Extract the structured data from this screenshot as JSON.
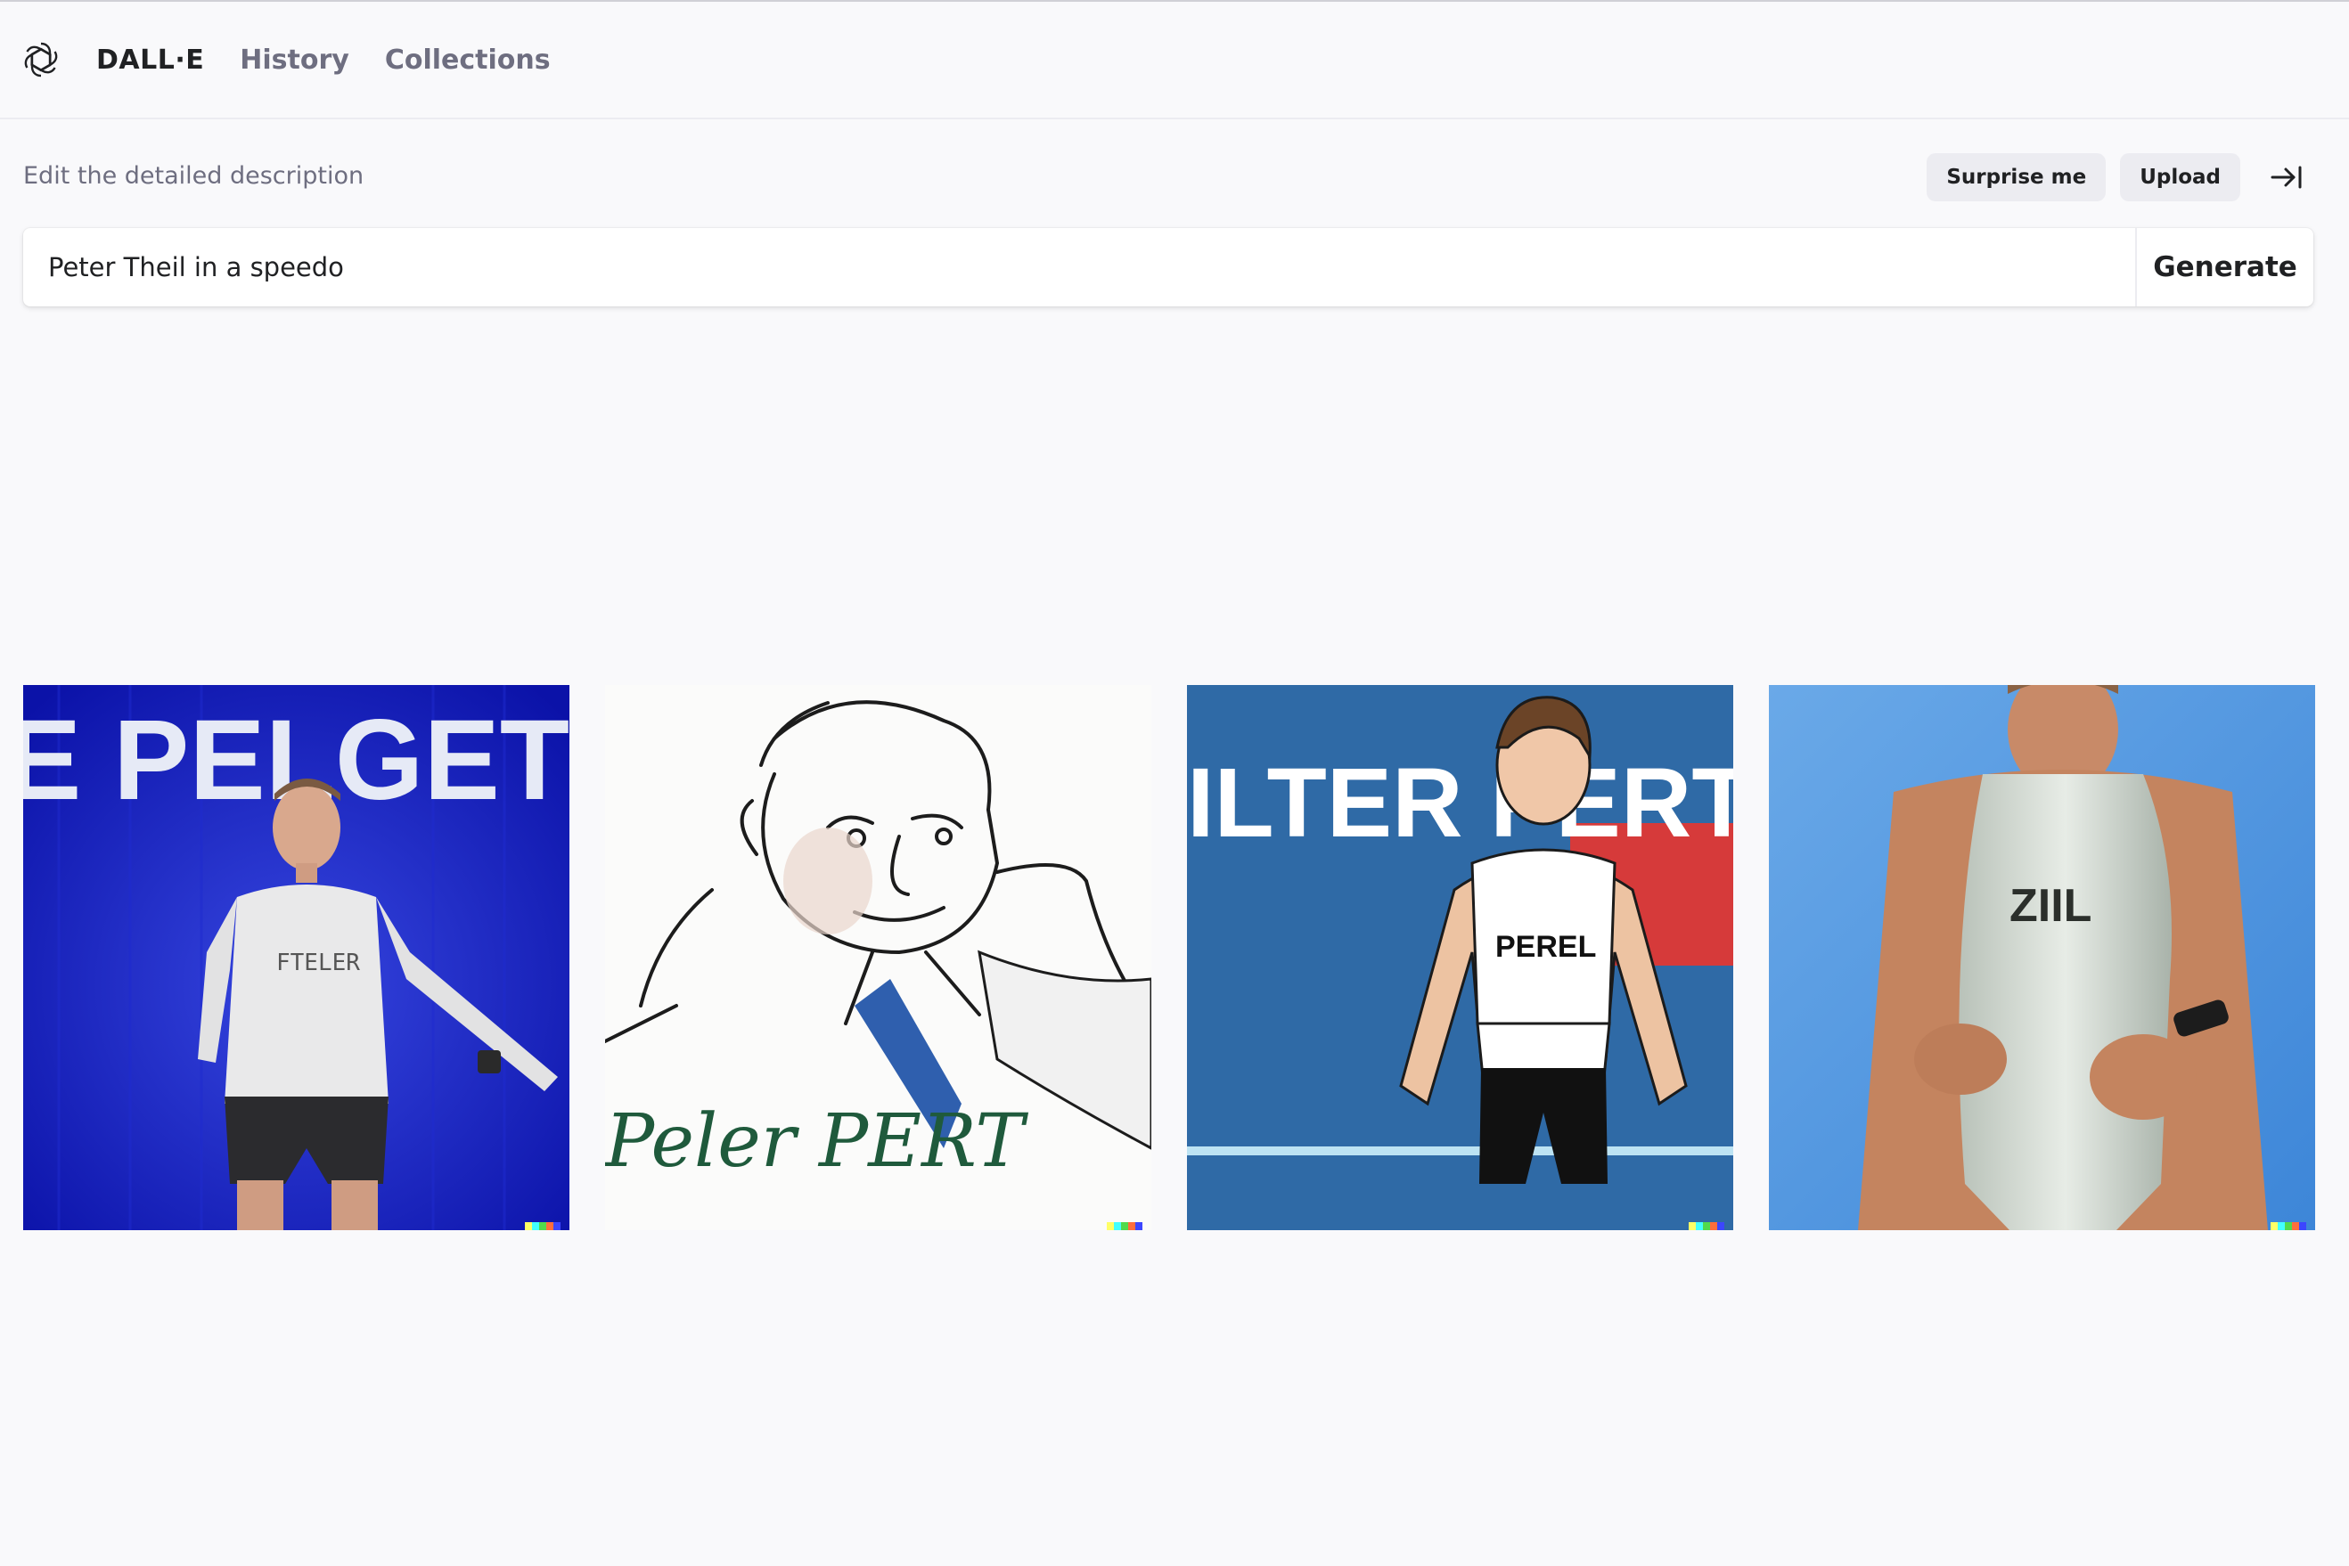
{
  "nav": {
    "logo_icon": "openai-logo-icon",
    "brand": "DALL·E",
    "links": [
      "History",
      "Collections"
    ]
  },
  "prompt": {
    "label": "Edit the detailed description",
    "value": "Peter Theil in a speedo",
    "generate_label": "Generate",
    "surprise_label": "Surprise me",
    "upload_label": "Upload",
    "collapse_icon": "arrow-to-right-bar-icon"
  },
  "images": [
    {
      "style": "photo",
      "shirt_text": "FTELER",
      "backdrop_text": "E PELGET"
    },
    {
      "style": "sketch",
      "caption_text": "Peler PERT"
    },
    {
      "style": "comic",
      "shirt_text": "PEREL",
      "backdrop_text": "ILTER PERT"
    },
    {
      "style": "photo",
      "shirt_text": "ZIIL"
    }
  ],
  "colors": {
    "background": "#f9f9fb",
    "text": "#202123",
    "muted": "#6e6e80",
    "pill": "#ececf1",
    "signature": [
      "#ffff66",
      "#42ffff",
      "#51da4c",
      "#ff6e3c",
      "#3c46ff"
    ]
  }
}
